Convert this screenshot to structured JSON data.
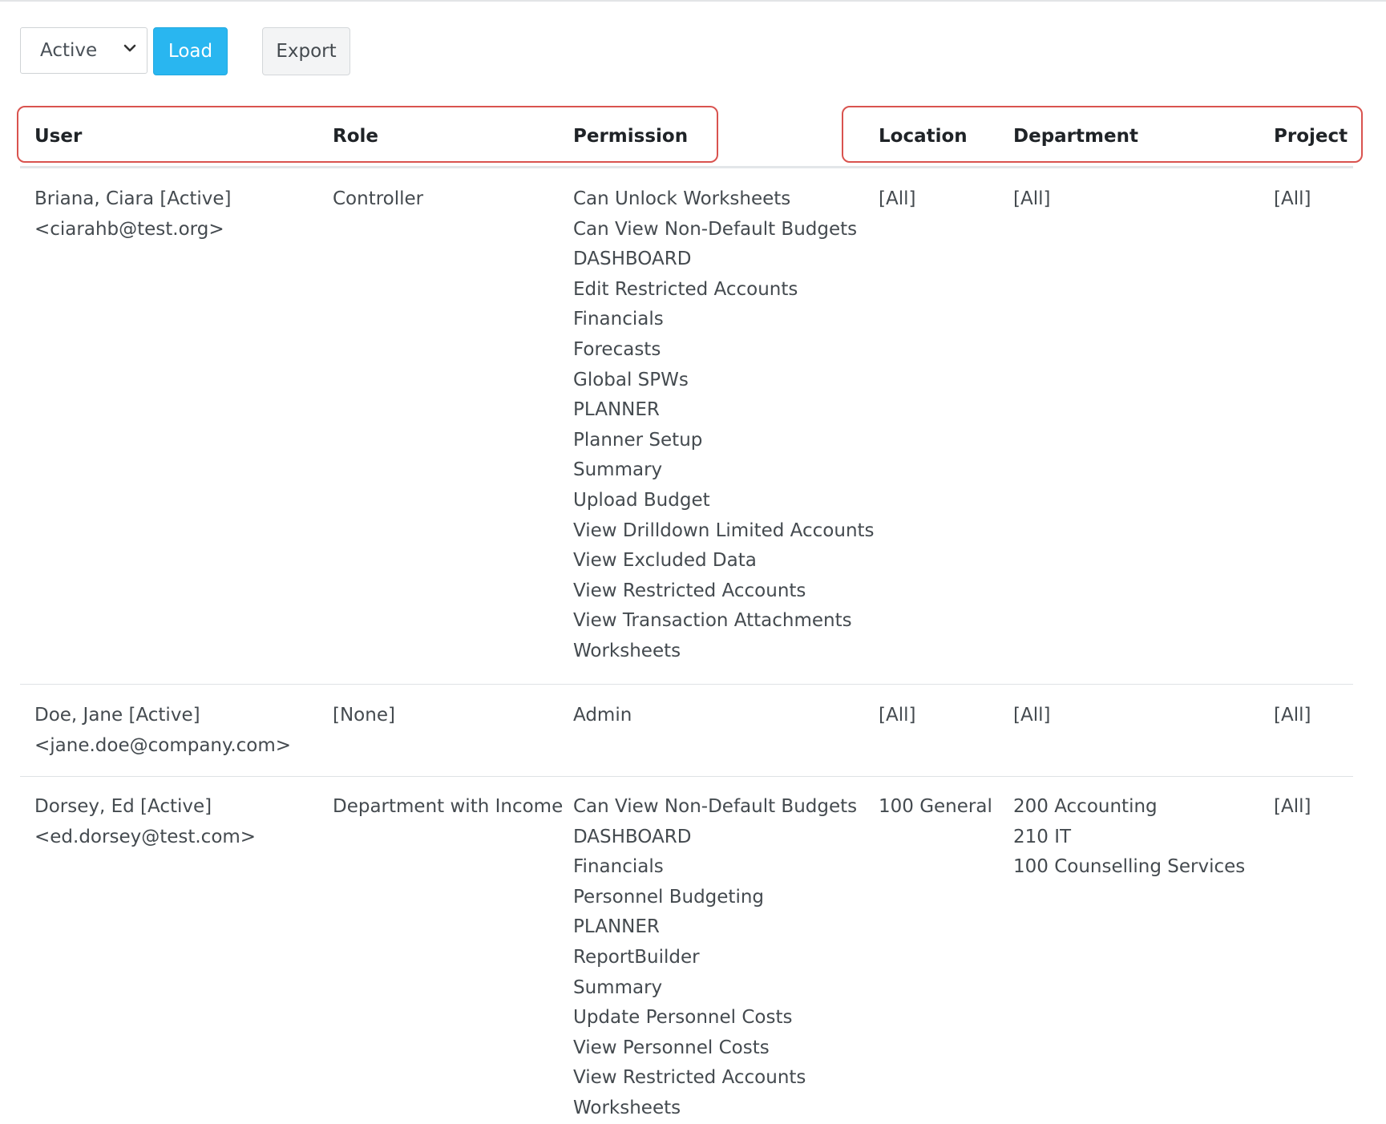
{
  "toolbar": {
    "status_select_value": "Active",
    "load_label": "Load",
    "export_label": "Export"
  },
  "columns": {
    "user": "User",
    "role": "Role",
    "permission": "Permission",
    "location": "Location",
    "department": "Department",
    "project": "Project"
  },
  "rows": [
    {
      "user_name": "Briana, Ciara [Active]",
      "user_email": "<ciarahb@test.org>",
      "role": "Controller",
      "permissions": [
        "Can Unlock Worksheets",
        "Can View Non-Default Budgets",
        "DASHBOARD",
        "Edit Restricted Accounts",
        "Financials",
        "Forecasts",
        "Global SPWs",
        "PLANNER",
        "Planner Setup",
        "Summary",
        "Upload Budget",
        "View Drilldown Limited Accounts",
        "View Excluded Data",
        "View Restricted Accounts",
        "View Transaction Attachments",
        "Worksheets"
      ],
      "location": [
        "[All]"
      ],
      "department": [
        "[All]"
      ],
      "project": [
        "[All]"
      ]
    },
    {
      "user_name": "Doe, Jane [Active]",
      "user_email": "<jane.doe@company.com>",
      "role": "[None]",
      "permissions": [
        "Admin"
      ],
      "location": [
        "[All]"
      ],
      "department": [
        "[All]"
      ],
      "project": [
        "[All]"
      ]
    },
    {
      "user_name": "Dorsey, Ed [Active]",
      "user_email": "<ed.dorsey@test.com>",
      "role": "Department with Income",
      "permissions": [
        "Can View Non-Default Budgets",
        "DASHBOARD",
        "Financials",
        "Personnel Budgeting",
        "PLANNER",
        "ReportBuilder",
        "Summary",
        "Update Personnel Costs",
        "View Personnel Costs",
        "View Restricted Accounts",
        "Worksheets"
      ],
      "location": [
        "100 General"
      ],
      "department": [
        "200 Accounting",
        "210 IT",
        "100 Counselling Services"
      ],
      "project": [
        "[All]"
      ]
    }
  ]
}
